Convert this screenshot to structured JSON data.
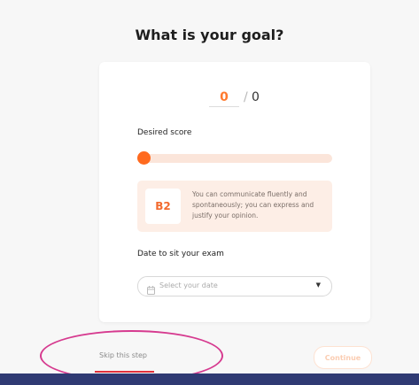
{
  "page": {
    "title": "What is your goal?"
  },
  "score": {
    "value": "0",
    "separator": "/",
    "max": "0"
  },
  "desired_score": {
    "label": "Desired score",
    "slider_fraction": 0.0
  },
  "level": {
    "badge": "B2",
    "description": "You can communicate fluently and spontaneously; you can express and justify your opinion."
  },
  "exam_date": {
    "label": "Date to sit your exam",
    "placeholder": "Select your date"
  },
  "actions": {
    "skip_label": "Skip this step",
    "continue_label": "Continue"
  },
  "icons": {
    "calendar": "calendar-icon",
    "dropdown": "caret-down-icon"
  },
  "colors": {
    "accent": "#ff6a1f",
    "annotation": "#d63a8f",
    "footer": "#2f3a73"
  }
}
